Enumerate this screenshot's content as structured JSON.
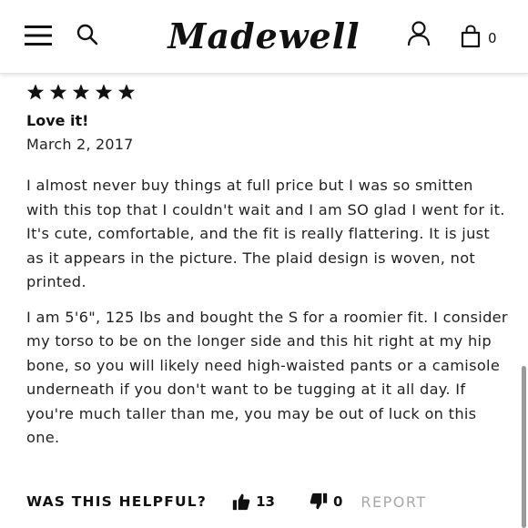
{
  "header": {
    "logo_text": "Madewell",
    "bag_count": "0"
  },
  "review": {
    "rating": 5,
    "title": "Love it!",
    "date": "March 2, 2017",
    "paragraphs": [
      "I almost never buy things at full price but I was so smitten with this top that I couldn't wait and I am SO glad I went for it. It's cute, comfortable, and the fit is really flattering. It is just as it appears in the picture. The plaid design is woven, not printed.",
      "I am 5'6\", 125 lbs and bought the S for a roomier fit. I consider my torso to be on the longer side and this hit right at my hip bone, so you will likely need high-waisted pants or a camisole underneath if you don't want to be tugging at it all day. If you're much taller than me, you may be out of luck on this one."
    ]
  },
  "helpful": {
    "label": "WAS THIS HELPFUL?",
    "up_count": "13",
    "down_count": "0",
    "report_label": "REPORT"
  },
  "colors": {
    "text": "#222222",
    "report": "#a8a8a8",
    "icon": "#111111"
  },
  "icons": {
    "menu": "hamburger-menu-icon",
    "search": "search-icon",
    "account": "user-icon",
    "bag": "shopping-bag-icon",
    "star": "star-icon",
    "thumbs_up": "thumbs-up-icon",
    "thumbs_down": "thumbs-down-icon"
  }
}
